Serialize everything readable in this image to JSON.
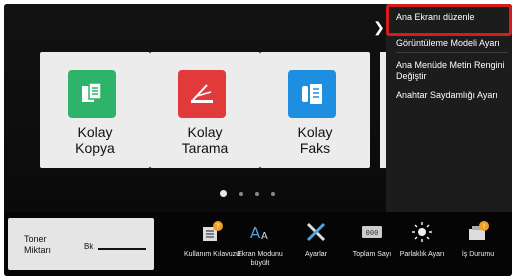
{
  "home": {
    "tiles": [
      {
        "line1": "Kolay",
        "line2": "Kopya",
        "icon": "copy-icon",
        "color": "#2db36a"
      },
      {
        "line1": "Kolay",
        "line2": "Tarama",
        "icon": "scan-icon",
        "color": "#e03a3a"
      },
      {
        "line1": "Kolay",
        "line2": "Faks",
        "icon": "fax-icon",
        "color": "#1e8fe0"
      }
    ],
    "page_indicator": {
      "count": 5,
      "active": 0
    }
  },
  "menu": {
    "expand_icon": "chevron-right-icon",
    "items": [
      {
        "label": "Ana Ekranı düzenle"
      },
      {
        "label": "Görüntüleme Modeli Ayarı"
      },
      {
        "label": "Ana Menüde Metin Rengini Değiştir"
      },
      {
        "label": "Anahtar Saydamlığı Ayarı"
      }
    ]
  },
  "status_bar": {
    "toner": {
      "label": "Toner Miktarı",
      "channel": "Bk"
    },
    "shortcuts": [
      {
        "label": "Kullanım Kılavuzu",
        "icon": "manual-icon"
      },
      {
        "label": "Ekran Modunu büyült",
        "icon": "enlarge-text-icon"
      },
      {
        "label": "Ayarlar",
        "icon": "settings-tools-icon"
      },
      {
        "label": "Toplam Sayı",
        "icon": "counter-icon"
      },
      {
        "label": "Parlaklık Ayarı",
        "icon": "brightness-icon"
      },
      {
        "label": "İş Durumu",
        "icon": "job-status-icon"
      }
    ]
  },
  "colors": {
    "highlight": "#d61b1b",
    "badge": "#f0a020"
  }
}
